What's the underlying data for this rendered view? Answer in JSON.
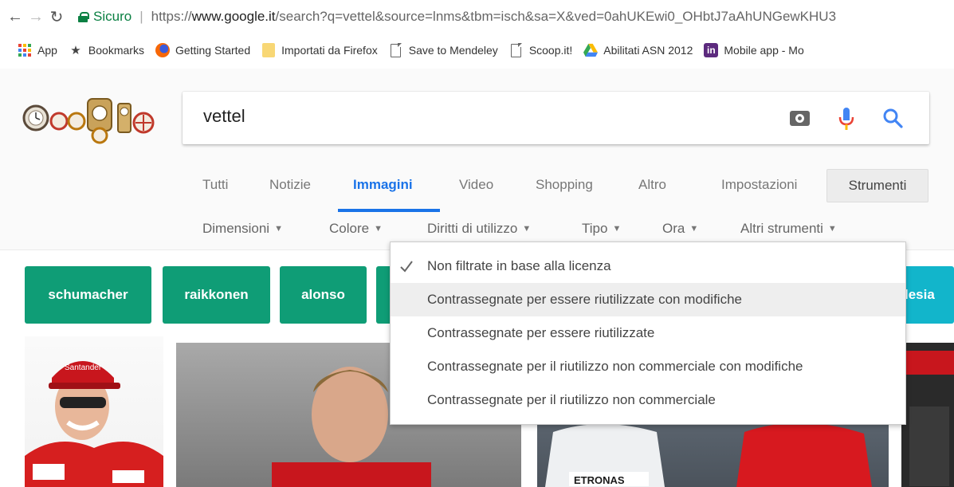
{
  "browser": {
    "secure_label": "Sicuro",
    "url_prefix": "https://",
    "url_host": "www.google.it",
    "url_rest": "/search?q=vettel&source=lnms&tbm=isch&sa=X&ved=0ahUKEwi0_OHbtJ7aAhUNGewKHU3",
    "bookmarks": [
      "App",
      "Bookmarks",
      "Getting Started",
      "Importati da Firefox",
      "Save to Mendeley",
      "Scoop.it!",
      "Abilitati ASN 2012",
      "Mobile app - Mo"
    ]
  },
  "search": {
    "query": "vettel"
  },
  "tabs": [
    "Tutti",
    "Notizie",
    "Immagini",
    "Video",
    "Shopping",
    "Altro",
    "Impostazioni"
  ],
  "active_tab": "Immagini",
  "strumenti_label": "Strumenti",
  "tools": [
    "Dimensioni",
    "Colore",
    "Diritti di utilizzo",
    "Tipo",
    "Ora",
    "Altri strumenti"
  ],
  "chips": [
    {
      "label": "schumacher",
      "color": "#0f9d76"
    },
    {
      "label": "raikkonen",
      "color": "#0f9d76"
    },
    {
      "label": "alonso",
      "color": "#0f9d76"
    },
    {
      "label": "",
      "color": "#0f9d76"
    },
    {
      "label": "lesia",
      "color": "#12b5cb"
    }
  ],
  "usage_rights_menu": {
    "selected": "Non filtrate in base alla licenza",
    "hovered": "Contrassegnate per essere riutilizzate con modifiche",
    "options": [
      "Non filtrate in base alla licenza",
      "Contrassegnate per essere riutilizzate con modifiche",
      "Contrassegnate per essere riutilizzate",
      "Contrassegnate per il riutilizzo non commerciale con modifiche",
      "Contrassegnate per il riutilizzo non commerciale"
    ]
  },
  "image_text": {
    "sponsor_a": "Santander",
    "sponsor_b": "ETRONAS"
  },
  "colors": {
    "accent": "#1a73e8",
    "secure": "#0b8043",
    "chip_green": "#0f9d76",
    "chip_teal": "#12b5cb"
  }
}
